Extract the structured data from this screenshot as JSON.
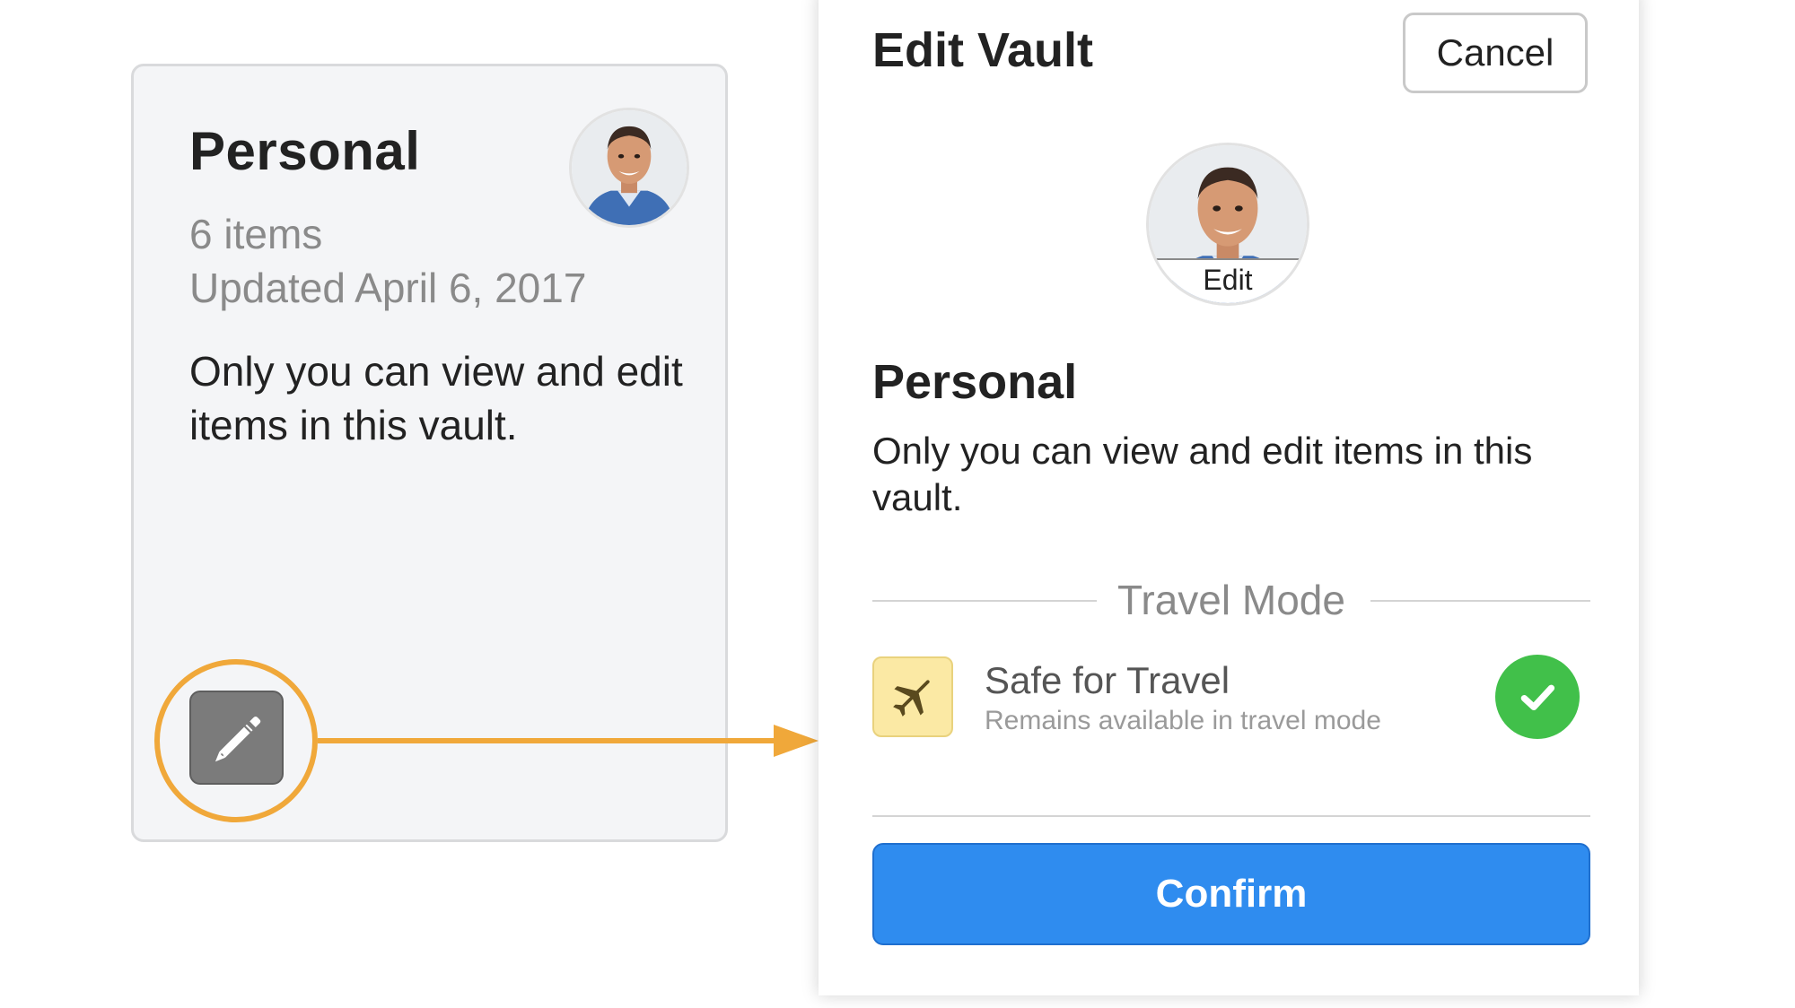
{
  "vault_card": {
    "title": "Personal",
    "item_count": "6 items",
    "updated": "Updated April 6, 2017",
    "description": "Only you can view and edit items in this vault.",
    "avatar_icon": "user-photo",
    "edit_icon": "pencil-icon"
  },
  "annotation": {
    "color": "#f0a83a"
  },
  "edit_panel": {
    "title": "Edit Vault",
    "cancel_label": "Cancel",
    "avatar_edit_label": "Edit",
    "vault_name": "Personal",
    "vault_description": "Only you can view and edit items in this vault.",
    "travel_section_label": "Travel Mode",
    "travel_item": {
      "icon": "airplane-icon",
      "title": "Safe for Travel",
      "subtitle": "Remains available in travel mode",
      "status_icon": "checkmark-icon",
      "enabled": true
    },
    "confirm_label": "Confirm"
  },
  "colors": {
    "confirm_button": "#2f8cef",
    "check_green": "#41c04a",
    "travel_icon_bg": "#fbe9a4",
    "card_bg": "#f4f5f7"
  }
}
